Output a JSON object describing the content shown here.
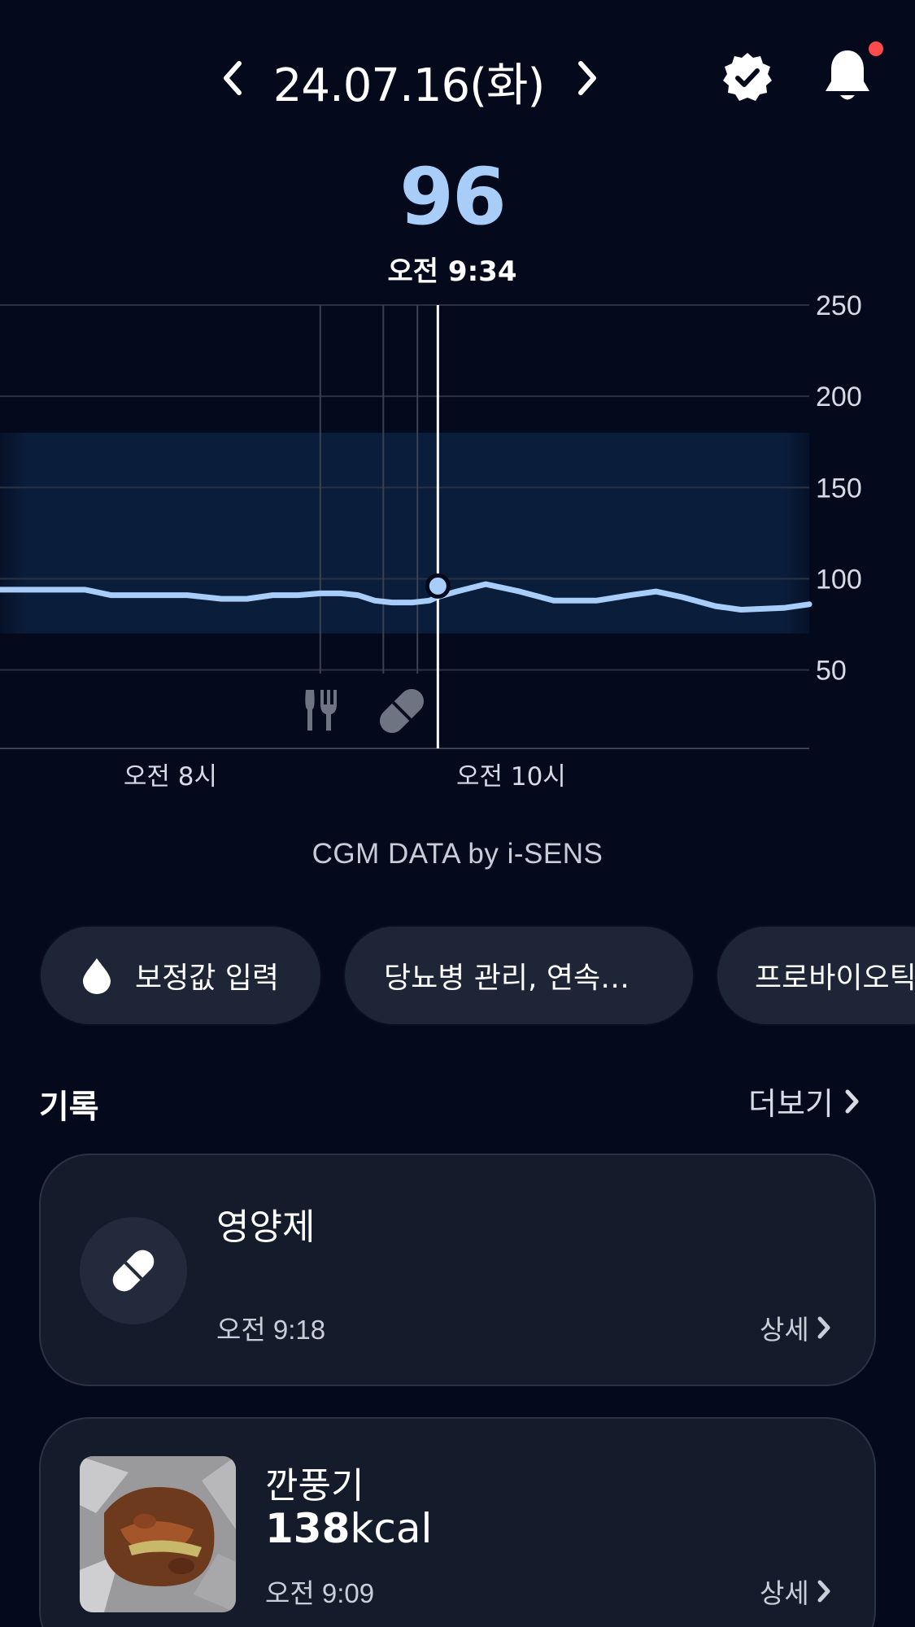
{
  "header": {
    "date": "24.07.16(화)",
    "prev_icon": "chevron-left-icon",
    "next_icon": "chevron-right-icon",
    "verified_icon": "verified-badge-icon",
    "notification_icon": "bell-icon",
    "notification_dot_color": "#ff4b4b"
  },
  "reading": {
    "value": "96",
    "time": "오전 9:34",
    "accent_color": "#a9cdf9"
  },
  "chart_data": {
    "type": "line",
    "x_tick_labels": [
      "오전 8시",
      "오전 10시"
    ],
    "y_ticks": [
      50,
      100,
      150,
      200,
      250
    ],
    "ylim": [
      7,
      250
    ],
    "target_range": [
      70,
      180
    ],
    "x_hours": [
      7.0,
      7.25,
      7.5,
      7.55,
      7.65,
      7.8,
      7.95,
      8.1,
      8.3,
      8.45,
      8.6,
      8.75,
      8.88,
      9.0,
      9.1,
      9.2,
      9.3,
      9.42,
      9.52,
      9.57,
      9.68,
      9.85,
      10.05,
      10.25,
      10.5,
      10.7,
      10.85,
      11.0,
      11.2,
      11.35,
      11.6,
      11.75
    ],
    "values": [
      94,
      94,
      94,
      93,
      91,
      91,
      91,
      91,
      89,
      89,
      91,
      91,
      92,
      92,
      91,
      88,
      87,
      87,
      88,
      90,
      93,
      97,
      93,
      88,
      88,
      91,
      93,
      90,
      85,
      83,
      84,
      86
    ],
    "selected": {
      "x_hour": 9.57,
      "value": 96
    },
    "event_lines_hours": [
      8.88,
      9.25,
      9.45
    ],
    "event_icons": [
      "fork-knife-icon",
      "pill-icon"
    ],
    "line_color": "#a9cdf9",
    "range_color": "#0a1d3a"
  },
  "credit": "CGM DATA by i-SENS",
  "chips": [
    {
      "label": "보정값 입력",
      "icon": "water-drop-icon"
    },
    {
      "label": "당뇨병 관리, 연속…"
    },
    {
      "label": "프로바이오틱"
    }
  ],
  "records": {
    "title": "기록",
    "more_label": "더보기",
    "items": [
      {
        "title": "영양제",
        "time": "오전 9:18",
        "detail_label": "상세",
        "icon": "pill-icon"
      },
      {
        "title": "깐풍기",
        "kcal_value": "138",
        "kcal_unit": "kcal",
        "time": "오전 9:09",
        "detail_label": "상세",
        "thumbnail": "food-photo"
      }
    ]
  }
}
